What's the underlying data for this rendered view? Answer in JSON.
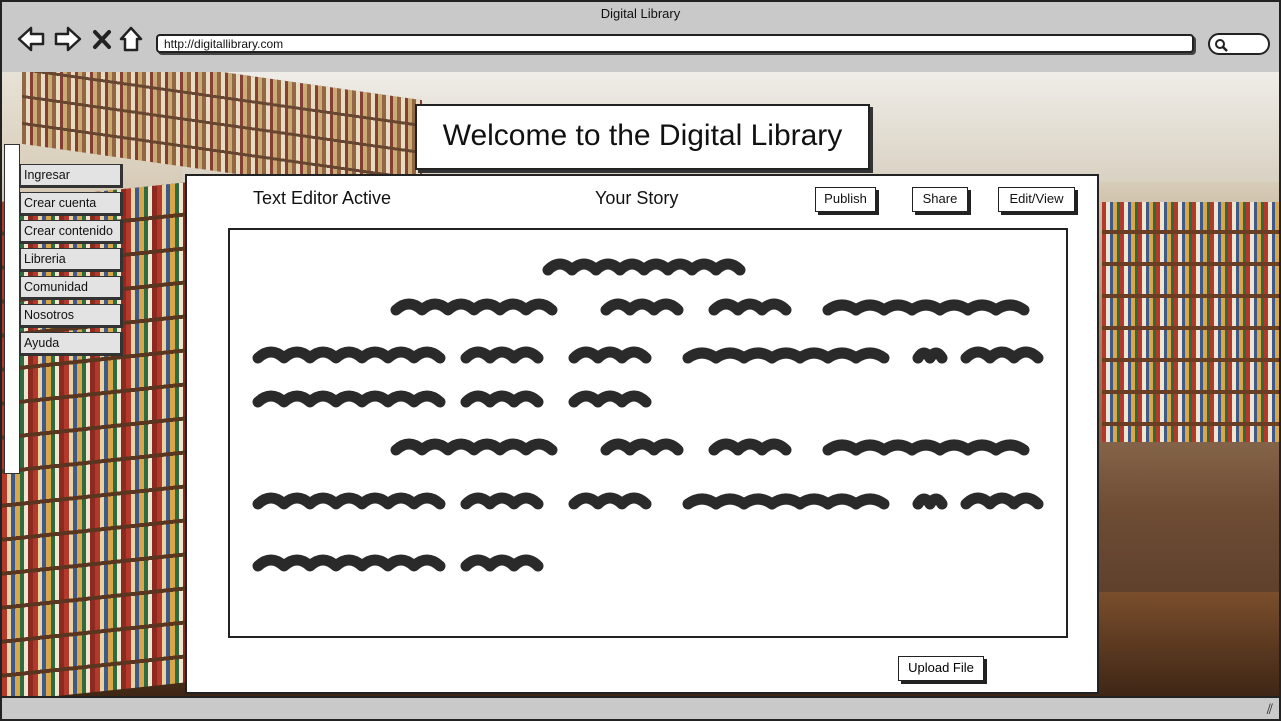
{
  "window": {
    "title": "Digital Library",
    "address": "http://digitallibrary.com"
  },
  "nav": {
    "back_icon": "arrow-left-icon",
    "forward_icon": "arrow-right-icon",
    "close_icon": "close-icon",
    "home_icon": "home-icon",
    "search_icon": "search-icon"
  },
  "page": {
    "welcome": "Welcome to the Digital Library"
  },
  "sidebar": {
    "items": [
      {
        "label": "Ingresar"
      },
      {
        "label": "Crear cuenta"
      },
      {
        "label": "Crear contenido"
      },
      {
        "label": "Libreria"
      },
      {
        "label": "Comunidad"
      },
      {
        "label": "Nosotros"
      },
      {
        "label": "Ayuda"
      }
    ]
  },
  "editor_panel": {
    "status": "Text Editor Active",
    "title": "Your Story",
    "publish_label": "Publish",
    "share_label": "Share",
    "edit_view_label": "Edit/View",
    "upload_label": "Upload File"
  }
}
